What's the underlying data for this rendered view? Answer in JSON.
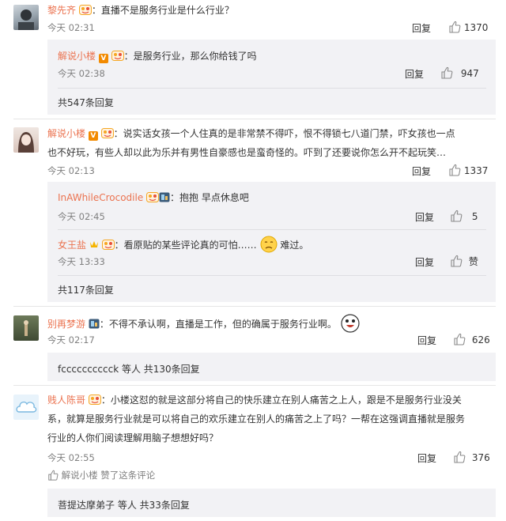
{
  "comments": [
    {
      "user": "黎先齐",
      "text": "：直播不是服务行业是什么行业？",
      "time": "今天 02:31",
      "reply_label": "回复",
      "likes": "1370",
      "replies": [
        {
          "user": "解说小楼",
          "text": "：是服务行业，那么你给钱了吗",
          "time": "今天 02:38",
          "reply_label": "回复",
          "likes": "947"
        }
      ],
      "more": "共547条回复"
    },
    {
      "user": "解说小楼",
      "text_line1": "：说实话女孩一个人住真的是非常禁不得吓，恨不得锁七八道门禁，吓女孩也一点",
      "text_line2": "也不好玩，有些人却以此为乐并有男性自豪感也是蛮奇怪的。吓到了还要说你怎么开不起玩笑…",
      "time": "今天 02:13",
      "reply_label": "回复",
      "likes": "1337",
      "replies": [
        {
          "user": "InAWhileCrocodile",
          "text": "：抱抱 早点休息吧",
          "time": "今天 02:45",
          "reply_label": "回复",
          "likes": "5"
        },
        {
          "user": "女王盐",
          "text": "：看原贴的某些评论真的可怕……",
          "text_after": "难过。",
          "time": "今天 13:33",
          "reply_label": "回复",
          "likes": "赞"
        }
      ],
      "more": "共117条回复"
    },
    {
      "user": "别再梦游",
      "text": "：不得不承认啊，直播是工作，但的确属于服务行业啊。",
      "time": "今天 02:17",
      "reply_label": "回复",
      "likes": "626",
      "more": "fcccccccccck 等人 共130条回复"
    },
    {
      "user": "贱人陈哥",
      "text_line1": "：小楼这怼的就是这部分将自己的快乐建立在别人痛苦之上人，跟是不是服务行业没关",
      "text_line2": "系，就算是服务行业就是可以将自己的欢乐建立在别人的痛苦之上了吗？一帮在这强调直播就是服务",
      "text_line3": "行业的人你们阅读理解用脑子想想好吗？",
      "time": "今天 02:55",
      "reply_label": "回复",
      "likes": "376",
      "liked_by": "解说小楼 赞了这条评论",
      "more": "菩提达摩弟子 等人 共33条回复"
    }
  ],
  "colors": {
    "username": "#eb7350",
    "meta": "#808080",
    "panel": "#f2f2f5"
  }
}
